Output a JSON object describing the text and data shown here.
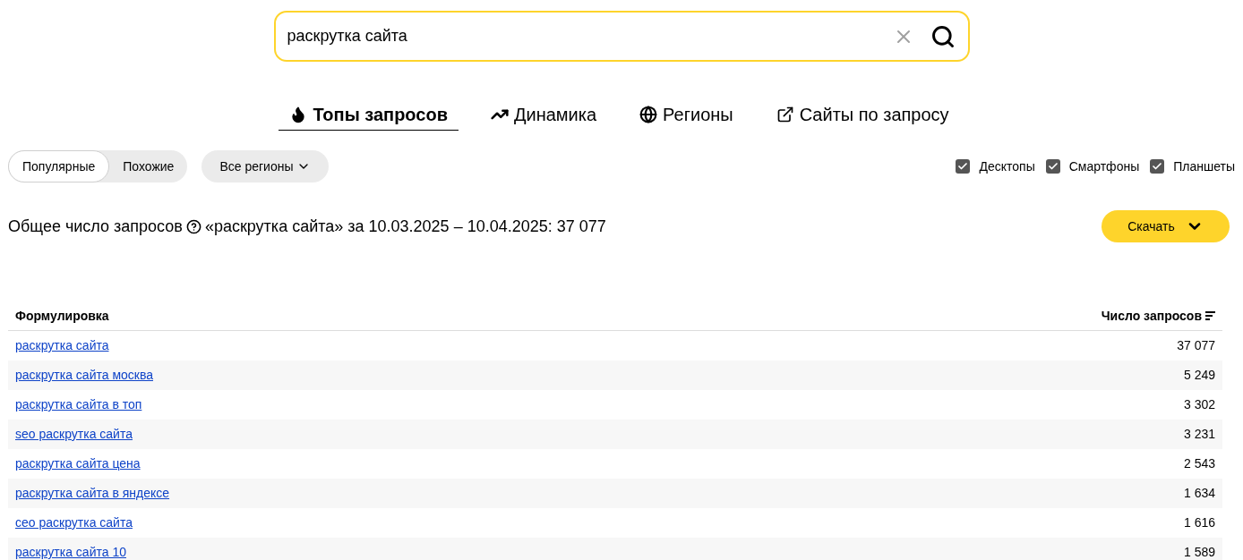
{
  "search": {
    "value": "раскрутка сайта"
  },
  "tabs": [
    {
      "label": "Топы запросов",
      "selected": true
    },
    {
      "label": "Динамика",
      "selected": false
    },
    {
      "label": "Регионы",
      "selected": false
    },
    {
      "label": "Сайты по запросу",
      "selected": false
    }
  ],
  "mode_toggle": [
    {
      "label": "Популярные",
      "selected": true
    },
    {
      "label": "Похожие",
      "selected": false
    }
  ],
  "region_dropdown": {
    "label": "Все регионы"
  },
  "devices": [
    {
      "label": "Десктопы",
      "checked": true
    },
    {
      "label": "Смартфоны",
      "checked": true
    },
    {
      "label": "Планшеты",
      "checked": true
    }
  ],
  "summary": {
    "label": "Общее число запросов",
    "details": "«раскрутка сайта» за 10.03.2025 – 10.04.2025: 37 077"
  },
  "download_button": {
    "label": "Скачать"
  },
  "table": {
    "columns": [
      "Формулировка",
      "Число запросов"
    ],
    "rows": [
      {
        "phrase": "раскрутка сайта",
        "count": "37 077"
      },
      {
        "phrase": "раскрутка сайта москва",
        "count": "5 249"
      },
      {
        "phrase": "раскрутка сайта в топ",
        "count": "3 302"
      },
      {
        "phrase": "seo раскрутка сайта",
        "count": "3 231"
      },
      {
        "phrase": "раскрутка сайта цена",
        "count": "2 543"
      },
      {
        "phrase": "раскрутка сайта в яндексе",
        "count": "1 634"
      },
      {
        "phrase": "сео раскрутка сайта",
        "count": "1 616"
      },
      {
        "phrase": "раскрутка сайта 10",
        "count": "1 589"
      }
    ]
  }
}
